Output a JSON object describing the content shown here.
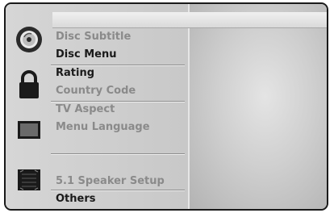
{
  "menu": {
    "items": [
      {
        "label": "Disc Subtitle",
        "state": "dim"
      },
      {
        "label": "Disc Menu",
        "state": "active"
      },
      {
        "label": "Rating",
        "state": "active"
      },
      {
        "label": "Country Code",
        "state": "dim"
      },
      {
        "label": "TV Aspect",
        "state": "dim"
      },
      {
        "label": "Menu Language",
        "state": "dim"
      },
      {
        "label": "5.1 Speaker Setup",
        "state": "dim"
      },
      {
        "label": "Others",
        "state": "active"
      }
    ]
  },
  "icons": [
    "disc-icon",
    "lock-icon",
    "tv-screen-icon",
    "speaker-icon"
  ],
  "colors": {
    "active_text": "#1a1a1a",
    "dim_text": "#8a8a8a",
    "panel": "#c8c8c8"
  }
}
